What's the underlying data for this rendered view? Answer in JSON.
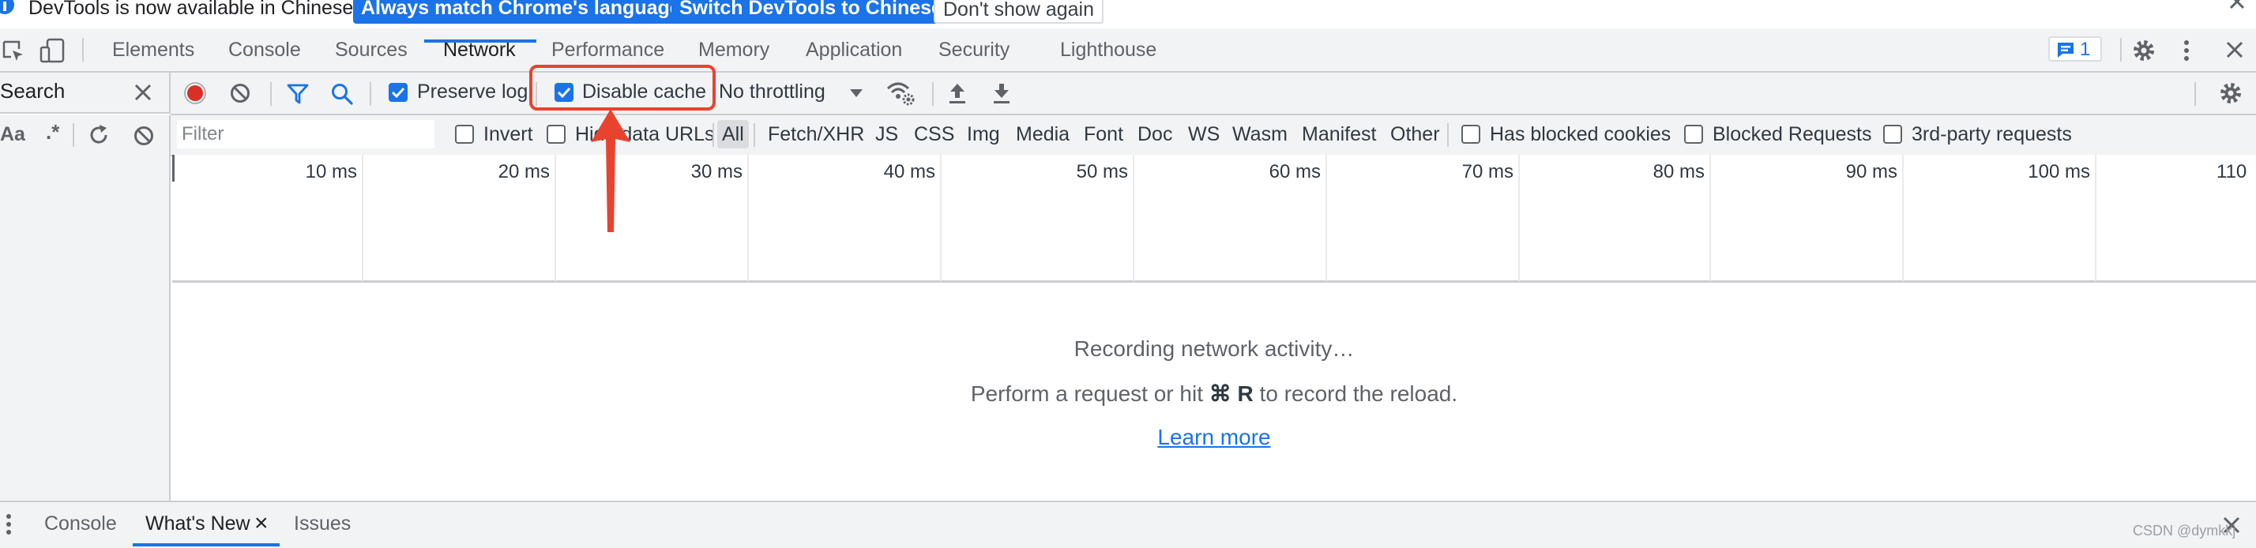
{
  "infobar": {
    "message": "DevTools is now available in Chinese!",
    "btn_match": "Always match Chrome's language",
    "btn_switch": "Switch DevTools to Chinese",
    "btn_dismiss": "Don't show again"
  },
  "tabs": [
    {
      "label": "Elements"
    },
    {
      "label": "Console"
    },
    {
      "label": "Sources"
    },
    {
      "label": "Network"
    },
    {
      "label": "Performance"
    },
    {
      "label": "Memory"
    },
    {
      "label": "Application"
    },
    {
      "label": "Security"
    },
    {
      "label": "Lighthouse"
    }
  ],
  "active_tab": "Network",
  "issues_count": "1",
  "search_panel": {
    "title": "Search",
    "match_case": "Aa",
    "regex": ".*"
  },
  "toolbar": {
    "preserve_log": "Preserve log",
    "disable_cache": "Disable cache",
    "throttling": "No throttling"
  },
  "filter": {
    "placeholder": "Filter",
    "invert": "Invert",
    "hide_data_urls": "Hide data URLs",
    "types": [
      "All",
      "Fetch/XHR",
      "JS",
      "CSS",
      "Img",
      "Media",
      "Font",
      "Doc",
      "WS",
      "Wasm",
      "Manifest",
      "Other"
    ],
    "has_blocked_cookies": "Has blocked cookies",
    "blocked_requests": "Blocked Requests",
    "third_party": "3rd-party requests"
  },
  "timeline": {
    "ticks": [
      "10 ms",
      "20 ms",
      "30 ms",
      "40 ms",
      "50 ms",
      "60 ms",
      "70 ms",
      "80 ms",
      "90 ms",
      "100 ms",
      "110"
    ]
  },
  "empty_state": {
    "line1": "Recording network activity…",
    "line2_prefix": "Perform a request or hit ",
    "shortcut": "⌘ R",
    "line2_suffix": " to record the reload.",
    "learn_more": "Learn more"
  },
  "drawer": {
    "tabs": [
      {
        "label": "Console"
      },
      {
        "label": "What's New"
      },
      {
        "label": "Issues"
      }
    ],
    "close_glyph": "×"
  },
  "watermark": "CSDN @dymkkj",
  "colors": {
    "accent": "#1a73e8",
    "record": "#d93025",
    "annotation": "#e8432f"
  }
}
